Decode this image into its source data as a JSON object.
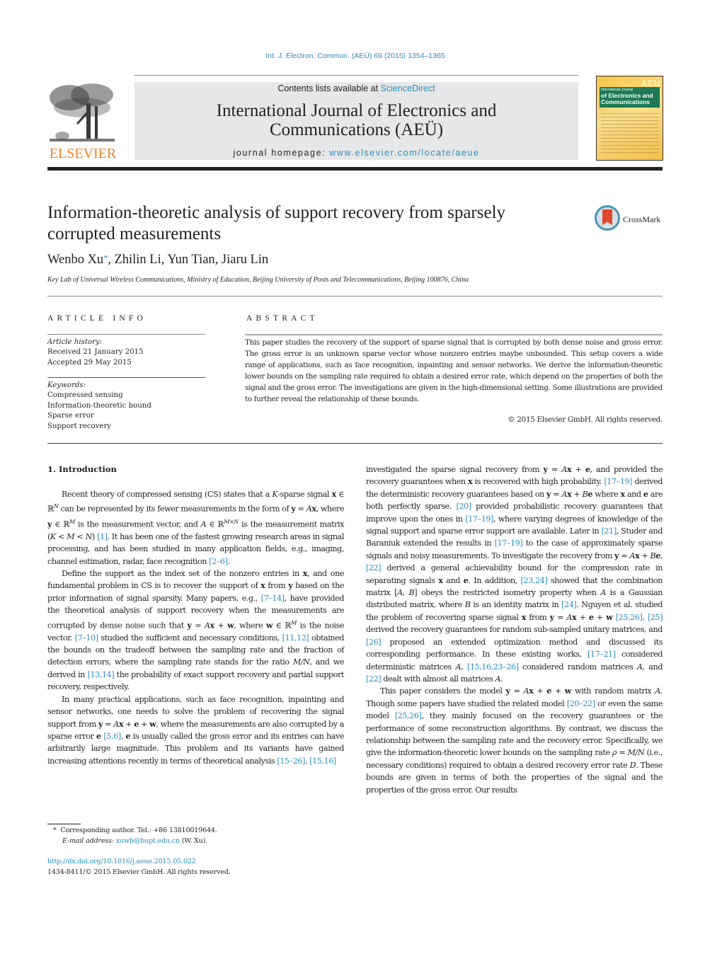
{
  "header": {
    "citation": "Int. J. Electron. Commun. (AEÜ) 69 (2015) 1354–1365",
    "contents_prefix": "Contents lists available at ",
    "contents_link": "ScienceDirect",
    "journal_title_line1": "International Journal of Electronics and",
    "journal_title_line2": "Communications (AEÜ)",
    "homepage_prefix": "journal homepage: ",
    "homepage_link": "www.elsevier.com/locate/aeue",
    "publisher_logo_text": "ELSEVIER",
    "cover": {
      "badge": "AEÜ",
      "line1": "International Journal",
      "line2": "of Electronics and",
      "line3": "Communications"
    }
  },
  "article": {
    "title": "Information-theoretic analysis of support recovery from sparsely corrupted measurements",
    "crossmark_label": "CrossMark",
    "authors": [
      {
        "name": "Wenbo Xu",
        "mark": "*"
      },
      {
        "name": "Zhilin Li",
        "mark": ""
      },
      {
        "name": "Yun Tian",
        "mark": ""
      },
      {
        "name": "Jiaru Lin",
        "mark": ""
      }
    ],
    "affiliation": "Key Lab of Universal Wireless Communications, Ministry of Education, Beijing University of Posts and Telecommunications, Beijing 100876, China"
  },
  "article_info": {
    "heading": "ARTICLE INFO",
    "history_label": "Article history:",
    "received": "Received 21 January 2015",
    "accepted": "Accepted 29 May 2015",
    "keywords_label": "Keywords:",
    "keywords": [
      "Compressed sensing",
      "Information-theoretic bound",
      "Sparse error",
      "Support recovery"
    ]
  },
  "abstract": {
    "heading": "ABSTRACT",
    "text": "This paper studies the recovery of the support of sparse signal that is corrupted by both dense noise and gross error. The gross error is an unknown sparse vector whose nonzero entries maybe unbounded. This setup covers a wide range of applications, such as face recognition, inpainting and sensor networks. We derive the information-theoretic lower bounds on the sampling rate required to obtain a desired error rate, which depend on the properties of both the signal and the gross error. The investigations are given in the high-dimensional setting. Some illustrations are provided to further reveal the relationship of these bounds.",
    "copyright": "© 2015 Elsevier GmbH. All rights reserved."
  },
  "body": {
    "section_heading": "1.  Introduction",
    "left_column": [
      [
        {
          "t": "Recent theory of compressed sensing (CS) states that a "
        },
        {
          "t": "K",
          "s": "i"
        },
        {
          "t": "-sparse signal "
        },
        {
          "t": "x",
          "s": "b"
        },
        {
          "t": " ∈ ℝ"
        },
        {
          "t": "N",
          "s": "sup"
        },
        {
          "t": " can be represented by its fewer measurements in the form of "
        },
        {
          "t": "y",
          "s": "b"
        },
        {
          "t": " = "
        },
        {
          "t": "A",
          "s": "i"
        },
        {
          "t": "x",
          "s": "b"
        },
        {
          "t": ", where "
        },
        {
          "t": "y",
          "s": "b"
        },
        {
          "t": " ∈ ℝ"
        },
        {
          "t": "M",
          "s": "sup"
        },
        {
          "t": " is the measurement vector, and "
        },
        {
          "t": "A",
          "s": "i"
        },
        {
          "t": " ∈ ℝ"
        },
        {
          "t": "M×N",
          "s": "sup"
        },
        {
          "t": " is the measurement matrix ("
        },
        {
          "t": "K",
          "s": "i"
        },
        {
          "t": " < "
        },
        {
          "t": "M",
          "s": "i"
        },
        {
          "t": " < "
        },
        {
          "t": "N",
          "s": "i"
        },
        {
          "t": ") "
        },
        {
          "t": "[1]",
          "s": "ref"
        },
        {
          "t": ". It has been one of the fastest growing research areas in signal processing, and has been studied in many application fields, e.g., imaging, channel estimation, radar, face recognition "
        },
        {
          "t": "[2–6]",
          "s": "ref"
        },
        {
          "t": "."
        }
      ],
      [
        {
          "t": "Define the support as the index set of the nonzero entries in "
        },
        {
          "t": "x",
          "s": "b"
        },
        {
          "t": ", and one fundamental problem in CS is to recover the support of "
        },
        {
          "t": "x",
          "s": "b"
        },
        {
          "t": " from "
        },
        {
          "t": "y",
          "s": "b"
        },
        {
          "t": " based on the prior information of signal sparsity. Many papers, e.g., "
        },
        {
          "t": "[7–14]",
          "s": "ref"
        },
        {
          "t": ", have provided the theoretical analysis of support recovery when the measurements are corrupted by dense noise such that "
        },
        {
          "t": "y",
          "s": "b"
        },
        {
          "t": " = "
        },
        {
          "t": "A",
          "s": "i"
        },
        {
          "t": "x",
          "s": "b"
        },
        {
          "t": " + "
        },
        {
          "t": "w",
          "s": "b"
        },
        {
          "t": ", where "
        },
        {
          "t": "w",
          "s": "b"
        },
        {
          "t": " ∈ ℝ"
        },
        {
          "t": "M",
          "s": "sup"
        },
        {
          "t": " is the noise vector. "
        },
        {
          "t": "[7–10]",
          "s": "ref"
        },
        {
          "t": " studied the sufficient and necessary conditions, "
        },
        {
          "t": "[11,12]",
          "s": "ref"
        },
        {
          "t": " obtained the bounds on the tradeoff between the sampling rate and the fraction of detection errors, where the sampling rate stands for the ratio "
        },
        {
          "t": "M/N",
          "s": "i"
        },
        {
          "t": ", and we derived in "
        },
        {
          "t": "[13,14]",
          "s": "ref"
        },
        {
          "t": " the probability of exact support recovery and partial support recovery, respectively."
        }
      ],
      [
        {
          "t": "In many practical applications, such as face recognition, inpainting and sensor networks, one needs to solve the problem of recovering the signal support from "
        },
        {
          "t": "y",
          "s": "b"
        },
        {
          "t": " = "
        },
        {
          "t": "A",
          "s": "i"
        },
        {
          "t": "x",
          "s": "b"
        },
        {
          "t": " + "
        },
        {
          "t": "e",
          "s": "b"
        },
        {
          "t": " + "
        },
        {
          "t": "w",
          "s": "b"
        },
        {
          "t": ", where the measurements are also corrupted by a sparse error "
        },
        {
          "t": "e",
          "s": "b"
        },
        {
          "t": " "
        },
        {
          "t": "[5,6]",
          "s": "ref"
        },
        {
          "t": ". "
        },
        {
          "t": "e",
          "s": "b"
        },
        {
          "t": " is usually called the gross error and its entries can have arbitrarily large magnitude. This problem and its variants have gained increasing attentions recently in terms of theoretical analysis "
        },
        {
          "t": "[15–26]",
          "s": "ref"
        },
        {
          "t": ". "
        },
        {
          "t": "[15,16]",
          "s": "ref"
        }
      ]
    ],
    "right_column": [
      [
        {
          "t": "investigated the sparse signal recovery from "
        },
        {
          "t": "y",
          "s": "b"
        },
        {
          "t": " = "
        },
        {
          "t": "A",
          "s": "i"
        },
        {
          "t": "x",
          "s": "b"
        },
        {
          "t": " + "
        },
        {
          "t": "e",
          "s": "b"
        },
        {
          "t": ", and provided the recovery guarantees when "
        },
        {
          "t": "x",
          "s": "b"
        },
        {
          "t": " is recovered with high probability. "
        },
        {
          "t": "[17–19]",
          "s": "ref"
        },
        {
          "t": " derived the deterministic recovery guarantees based on "
        },
        {
          "t": "y",
          "s": "b"
        },
        {
          "t": " = "
        },
        {
          "t": "A",
          "s": "i"
        },
        {
          "t": "x",
          "s": "b"
        },
        {
          "t": " + "
        },
        {
          "t": "B",
          "s": "i"
        },
        {
          "t": "e",
          "s": "b"
        },
        {
          "t": " where "
        },
        {
          "t": "x",
          "s": "b"
        },
        {
          "t": " and "
        },
        {
          "t": "e",
          "s": "b"
        },
        {
          "t": " are both perfectly sparse. "
        },
        {
          "t": "[20]",
          "s": "ref"
        },
        {
          "t": " provided probabilistic recovery guarantees that improve upon the ones in "
        },
        {
          "t": "[17–19]",
          "s": "ref"
        },
        {
          "t": ", where varying degrees of knowledge of the signal support and sparse error support are available. Later in "
        },
        {
          "t": "[21]",
          "s": "ref"
        },
        {
          "t": ", Studer and Baraniuk extended the results in "
        },
        {
          "t": "[17–19]",
          "s": "ref"
        },
        {
          "t": " to the case of approximately sparse signals and noisy measurements. To investigate the recovery from "
        },
        {
          "t": "y",
          "s": "b"
        },
        {
          "t": " = "
        },
        {
          "t": "A",
          "s": "i"
        },
        {
          "t": "x",
          "s": "b"
        },
        {
          "t": " + "
        },
        {
          "t": "B",
          "s": "i"
        },
        {
          "t": "e",
          "s": "b"
        },
        {
          "t": ", "
        },
        {
          "t": "[22]",
          "s": "ref"
        },
        {
          "t": " derived a general achievability bound for the compression rate in separating signals "
        },
        {
          "t": "x",
          "s": "b"
        },
        {
          "t": " and "
        },
        {
          "t": "e",
          "s": "b"
        },
        {
          "t": ". In addition, "
        },
        {
          "t": "[23,24]",
          "s": "ref"
        },
        {
          "t": " showed that the combination matrix ["
        },
        {
          "t": "A",
          "s": "i"
        },
        {
          "t": ", "
        },
        {
          "t": "B",
          "s": "i"
        },
        {
          "t": "] obeys the restricted isometry property when "
        },
        {
          "t": "A",
          "s": "i"
        },
        {
          "t": " is a Gaussian distributed matrix, where "
        },
        {
          "t": "B",
          "s": "i"
        },
        {
          "t": " is an identity matrix in "
        },
        {
          "t": "[24]",
          "s": "ref"
        },
        {
          "t": ". Nguyen et al. studied the problem of recovering sparse signal "
        },
        {
          "t": "x",
          "s": "b"
        },
        {
          "t": " from "
        },
        {
          "t": "y",
          "s": "b"
        },
        {
          "t": " = "
        },
        {
          "t": "A",
          "s": "i"
        },
        {
          "t": "x",
          "s": "b"
        },
        {
          "t": " + "
        },
        {
          "t": "e",
          "s": "b"
        },
        {
          "t": " + "
        },
        {
          "t": "w",
          "s": "b"
        },
        {
          "t": " "
        },
        {
          "t": "[25,26]",
          "s": "ref"
        },
        {
          "t": ". "
        },
        {
          "t": "[25]",
          "s": "ref"
        },
        {
          "t": " derived the recovery guarantees for random sub-sampled unitary matrices, and "
        },
        {
          "t": "[26]",
          "s": "ref"
        },
        {
          "t": " proposed an extended optimization method and discussed its corresponding performance. In these existing works, "
        },
        {
          "t": "[17–21]",
          "s": "ref"
        },
        {
          "t": " considered deterministic matrices "
        },
        {
          "t": "A",
          "s": "i"
        },
        {
          "t": ", "
        },
        {
          "t": "[15,16,23–26]",
          "s": "ref"
        },
        {
          "t": " considered random matrices "
        },
        {
          "t": "A",
          "s": "i"
        },
        {
          "t": ", and "
        },
        {
          "t": "[22]",
          "s": "ref"
        },
        {
          "t": " dealt with almost all matrices "
        },
        {
          "t": "A",
          "s": "i"
        },
        {
          "t": "."
        }
      ],
      [
        {
          "t": "This paper considers the model "
        },
        {
          "t": "y",
          "s": "b"
        },
        {
          "t": " = "
        },
        {
          "t": "A",
          "s": "i"
        },
        {
          "t": "x",
          "s": "b"
        },
        {
          "t": " + "
        },
        {
          "t": "e",
          "s": "b"
        },
        {
          "t": " + "
        },
        {
          "t": "w",
          "s": "b"
        },
        {
          "t": " with random matrix "
        },
        {
          "t": "A",
          "s": "i"
        },
        {
          "t": ". Though some papers have studied the related model "
        },
        {
          "t": "[20–22]",
          "s": "ref"
        },
        {
          "t": " or even the same model "
        },
        {
          "t": "[25,26]",
          "s": "ref"
        },
        {
          "t": ", they mainly focused on the recovery guarantees or the performance of some reconstruction algorithms. By contrast, we discuss the relationship between the sampling rate and the recovery error. Specifically, we give the information-theoretic lower bounds on the sampling rate "
        },
        {
          "t": "ρ",
          "s": "i"
        },
        {
          "t": " = "
        },
        {
          "t": "M/N",
          "s": "i"
        },
        {
          "t": " (i.e., necessary conditions) required to obtain a desired recovery error rate "
        },
        {
          "t": "D",
          "s": "i"
        },
        {
          "t": ". These bounds are given in terms of both the properties of the signal and the properties of the gross error. Our results"
        }
      ]
    ]
  },
  "footnotes": {
    "star": "*",
    "corresponding": "Corresponding author. Tel.: +86 13810019644.",
    "email_label": "E-mail address: ",
    "email": "xuwb@bupt.edu.cn",
    "email_suffix": " (W. Xu).",
    "doi": "http://dx.doi.org/10.1016/j.aeue.2015.05.022",
    "issn_line": "1434-8411/© 2015 Elsevier GmbH. All rights reserved."
  },
  "colors": {
    "link": "#2a8cbf",
    "elsevier_orange": "#f58220",
    "header_box": "#e6e7e8",
    "text": "#231f20"
  }
}
